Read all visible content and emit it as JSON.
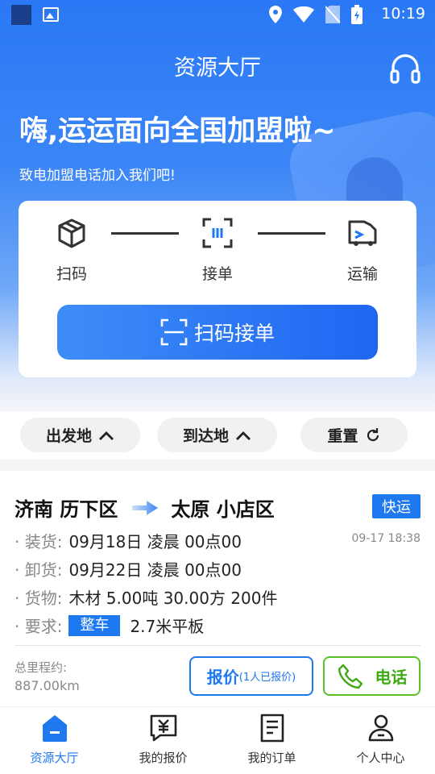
{
  "status_bar": {
    "time": "10:19"
  },
  "header": {
    "title": "资源大厅",
    "icons": [
      "headset-icon"
    ]
  },
  "banner": {
    "title": "嗨,运运面向全国加盟啦~",
    "subtitle": "致电加盟电话加入我们吧!"
  },
  "flow": {
    "steps": [
      {
        "label": "扫码",
        "icon": "package-icon"
      },
      {
        "label": "接单",
        "icon": "scan-frame-icon"
      },
      {
        "label": "运输",
        "icon": "truck-icon"
      }
    ],
    "scan_button": "扫码接单"
  },
  "filters": {
    "departure": "出发地",
    "arrival": "到达地",
    "reset": "重置"
  },
  "order": {
    "from": "济南 历下区",
    "to": "太原 小店区",
    "tag": "快运",
    "timestamp": "09-17 18:38",
    "rows": [
      {
        "key": "· 装货:",
        "value": "09月18日 凌晨 00点00"
      },
      {
        "key": "· 卸货:",
        "value": "09月22日 凌晨 00点00"
      },
      {
        "key": "· 货物:",
        "value": "木材 5.00吨 30.00方 200件"
      },
      {
        "key": "· 要求:",
        "tag": "整车",
        "value": "2.7米平板"
      }
    ],
    "distance_label": "总里程约:",
    "distance_value": "887.00km",
    "quote_label": "报价",
    "quote_count": "(1人已报价)",
    "phone_label": "电话"
  },
  "tabs": [
    {
      "label": "资源大厅",
      "active": true
    },
    {
      "label": "我的报价",
      "active": false
    },
    {
      "label": "我的订单",
      "active": false
    },
    {
      "label": "个人中心",
      "active": false
    }
  ],
  "colors": {
    "primary": "#1e78f0",
    "green": "#5ac226",
    "hero": "#2a78f5"
  }
}
